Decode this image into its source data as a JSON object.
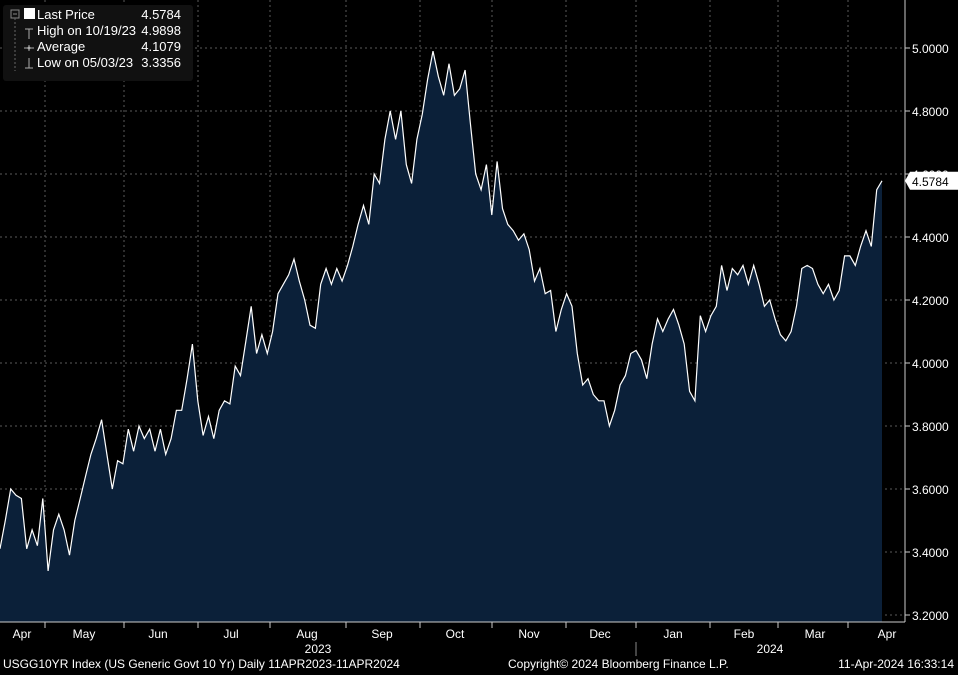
{
  "chart_data": {
    "type": "area",
    "title": "USGG10YR Index (US Generic Govt 10 Yr)",
    "frequency": "Daily",
    "range": "11APR2023-11APR2024",
    "ylim": [
      3.2,
      5.1
    ],
    "yticks": [
      "3.2000",
      "3.4000",
      "3.6000",
      "3.8000",
      "4.0000",
      "4.2000",
      "4.4000",
      "4.6000",
      "4.8000",
      "5.0000"
    ],
    "ytick_values": [
      3.2,
      3.4,
      3.6,
      3.8,
      4.0,
      4.2,
      4.4,
      4.6,
      4.8,
      5.0
    ],
    "xticks": [
      "Apr",
      "May",
      "Jun",
      "Jul",
      "Aug",
      "Sep",
      "Oct",
      "Nov",
      "Dec",
      "Jan",
      "Feb",
      "Mar",
      "Apr"
    ],
    "years": [
      "2023",
      "2024"
    ],
    "last_price_tag": "4.5784",
    "grid": true,
    "values": [
      3.41,
      3.5,
      3.6,
      3.58,
      3.57,
      3.41,
      3.47,
      3.42,
      3.57,
      3.34,
      3.47,
      3.52,
      3.47,
      3.39,
      3.5,
      3.57,
      3.64,
      3.71,
      3.76,
      3.82,
      3.71,
      3.6,
      3.69,
      3.68,
      3.79,
      3.72,
      3.8,
      3.76,
      3.79,
      3.72,
      3.79,
      3.71,
      3.76,
      3.85,
      3.85,
      3.95,
      4.06,
      3.88,
      3.77,
      3.83,
      3.76,
      3.85,
      3.88,
      3.87,
      3.99,
      3.96,
      4.07,
      4.18,
      4.03,
      4.09,
      4.03,
      4.1,
      4.22,
      4.25,
      4.28,
      4.33,
      4.26,
      4.2,
      4.12,
      4.11,
      4.25,
      4.3,
      4.25,
      4.3,
      4.26,
      4.31,
      4.37,
      4.44,
      4.5,
      4.44,
      4.6,
      4.57,
      4.71,
      4.8,
      4.71,
      4.8,
      4.63,
      4.57,
      4.71,
      4.79,
      4.9,
      4.99,
      4.91,
      4.85,
      4.95,
      4.85,
      4.87,
      4.93,
      4.76,
      4.6,
      4.55,
      4.63,
      4.47,
      4.64,
      4.49,
      4.44,
      4.42,
      4.39,
      4.41,
      4.36,
      4.26,
      4.3,
      4.22,
      4.23,
      4.1,
      4.17,
      4.22,
      4.18,
      4.03,
      3.93,
      3.95,
      3.9,
      3.88,
      3.88,
      3.8,
      3.85,
      3.93,
      3.96,
      4.03,
      4.04,
      4.01,
      3.95,
      4.06,
      4.14,
      4.1,
      4.14,
      4.17,
      4.12,
      4.06,
      3.91,
      3.88,
      4.15,
      4.1,
      4.15,
      4.18,
      4.31,
      4.23,
      4.3,
      4.28,
      4.31,
      4.25,
      4.31,
      4.25,
      4.18,
      4.2,
      4.14,
      4.09,
      4.07,
      4.1,
      4.18,
      4.3,
      4.31,
      4.3,
      4.25,
      4.22,
      4.25,
      4.2,
      4.23,
      4.34,
      4.34,
      4.31,
      4.37,
      4.42,
      4.37,
      4.55,
      4.5784
    ]
  },
  "legend": [
    {
      "label": "Last Price",
      "value": "4.5784"
    },
    {
      "label": "High on 10/19/23",
      "value": "4.9898"
    },
    {
      "label": "Average",
      "value": "4.1079"
    },
    {
      "label": "Low on 05/03/23",
      "value": "3.3356"
    }
  ],
  "footer": {
    "left": "USGG10YR Index (US Generic Govt 10 Yr)  Daily 11APR2023-11APR2024",
    "center": "Copyright© 2024 Bloomberg Finance L.P.",
    "right": "11-Apr-2024 16:33:14"
  },
  "colors": {
    "fill": "#0b2039",
    "line": "#ffffff",
    "grid": "#5a5a5a"
  }
}
